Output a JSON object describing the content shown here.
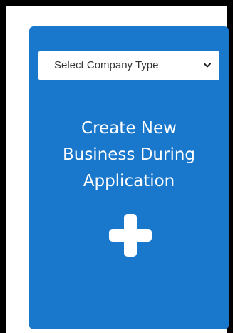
{
  "company_type_select": {
    "selected": "Select Company Type",
    "icon": "chevron-down-icon"
  },
  "card": {
    "title": "Create New\nBusiness During\nApplication",
    "action_icon": "plus-icon",
    "color": "#1977cc"
  }
}
